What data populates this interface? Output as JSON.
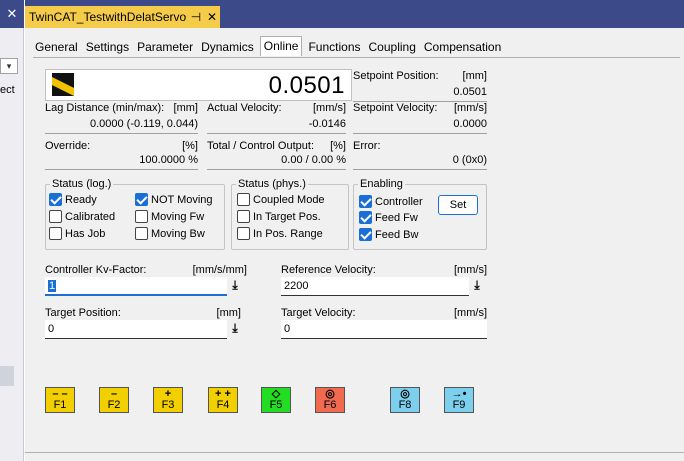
{
  "window": {
    "doc_tab_title": "TwinCAT_TestwithDelatServo",
    "pin_glyph": "⊣",
    "close_glyph": "✕"
  },
  "left_strip": {
    "close_glyph": "✕",
    "dropdown_glyph": "▾",
    "partial_text": "ect"
  },
  "tabs": [
    "General",
    "Settings",
    "Parameter",
    "Dynamics",
    "Online",
    "Functions",
    "Coupling",
    "Compensation"
  ],
  "active_tab": "Online",
  "online": {
    "actual_position": "0.0501",
    "setpoint_position": {
      "label": "Setpoint Position:",
      "unit": "[mm]",
      "value": "0.0501"
    },
    "lag_distance": {
      "label": "Lag Distance (min/max):",
      "unit": "[mm]",
      "value": "0.0000  (-0.119, 0.044)"
    },
    "actual_velocity": {
      "label": "Actual Velocity:",
      "unit": "[mm/s]",
      "value": "-0.0146"
    },
    "setpoint_velocity": {
      "label": "Setpoint Velocity:",
      "unit": "[mm/s]",
      "value": "0.0000"
    },
    "override": {
      "label": "Override:",
      "unit": "[%]",
      "value": "100.0000 %"
    },
    "control_output": {
      "label": "Total / Control Output:",
      "unit": "[%]",
      "value": "0.00 /  0.00 %"
    },
    "error": {
      "label": "Error:",
      "value": "0 (0x0)"
    }
  },
  "status_log": {
    "title": "Status (log.)",
    "items": [
      {
        "label": "Ready",
        "checked": true
      },
      {
        "label": "NOT Moving",
        "checked": true
      },
      {
        "label": "Calibrated",
        "checked": false
      },
      {
        "label": "Moving Fw",
        "checked": false
      },
      {
        "label": "Has Job",
        "checked": false
      },
      {
        "label": "Moving Bw",
        "checked": false
      }
    ]
  },
  "status_phys": {
    "title": "Status (phys.)",
    "items": [
      {
        "label": "Coupled Mode",
        "checked": false
      },
      {
        "label": "In Target Pos.",
        "checked": false
      },
      {
        "label": "In Pos. Range",
        "checked": false
      }
    ]
  },
  "enabling": {
    "title": "Enabling",
    "items": [
      {
        "label": "Controller",
        "checked": true
      },
      {
        "label": "Feed Fw",
        "checked": true
      },
      {
        "label": "Feed Bw",
        "checked": true
      }
    ],
    "set_label": "Set"
  },
  "inputs": {
    "kv_factor": {
      "label": "Controller Kv-Factor:",
      "unit": "[mm/s/mm]",
      "value": "1"
    },
    "reference_velocity": {
      "label": "Reference Velocity:",
      "unit": "[mm/s]",
      "value": "2200"
    },
    "target_position": {
      "label": "Target Position:",
      "unit": "[mm]",
      "value": "0"
    },
    "target_velocity": {
      "label": "Target Velocity:",
      "unit": "[mm/s]",
      "value": "0"
    },
    "download_glyph": "⤓"
  },
  "function_keys": [
    {
      "key": "F1",
      "symbol": "– –",
      "color": "#f2d000"
    },
    {
      "key": "F2",
      "symbol": "–",
      "color": "#f2d000"
    },
    {
      "key": "F3",
      "symbol": "+",
      "color": "#f2d000"
    },
    {
      "key": "F4",
      "symbol": "+ +",
      "color": "#f2d000"
    },
    {
      "key": "F5",
      "symbol": "◇",
      "color": "#22dd22"
    },
    {
      "key": "F6",
      "symbol": "◎",
      "color": "#f06a50"
    },
    {
      "key": "F8",
      "symbol": "◎",
      "color": "#7cd0ee"
    },
    {
      "key": "F9",
      "symbol": "→•",
      "color": "#7cd0ee"
    }
  ],
  "colors": {
    "title_bar": "#3c4a8a",
    "doc_tab": "#f5cc4a",
    "accent": "#1a6fd4"
  }
}
